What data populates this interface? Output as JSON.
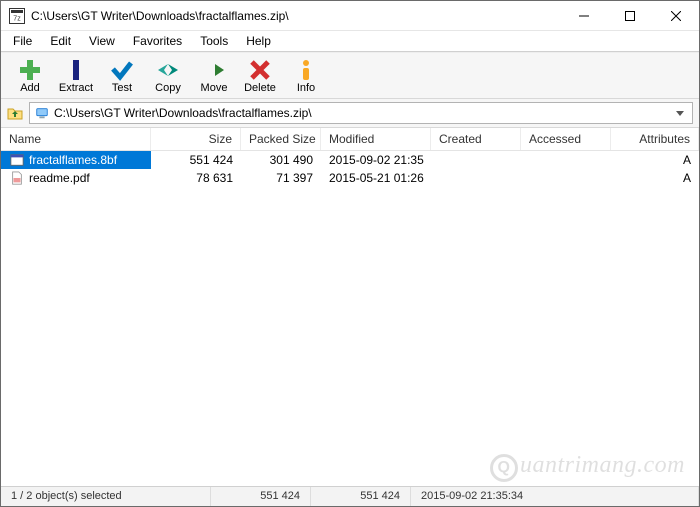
{
  "window": {
    "title": "C:\\Users\\GT Writer\\Downloads\\fractalflames.zip\\"
  },
  "menu": {
    "file": "File",
    "edit": "Edit",
    "view": "View",
    "favorites": "Favorites",
    "tools": "Tools",
    "help": "Help"
  },
  "toolbar": {
    "add": "Add",
    "extract": "Extract",
    "test": "Test",
    "copy": "Copy",
    "move": "Move",
    "delete": "Delete",
    "info": "Info"
  },
  "pathbar": {
    "path": "C:\\Users\\GT Writer\\Downloads\\fractalflames.zip\\"
  },
  "columns": {
    "name": "Name",
    "size": "Size",
    "packed": "Packed Size",
    "modified": "Modified",
    "created": "Created",
    "accessed": "Accessed",
    "attributes": "Attributes"
  },
  "rows": [
    {
      "name": "fractalflames.8bf",
      "size": "551 424",
      "packed": "301 490",
      "modified": "2015-09-02 21:35",
      "created": "",
      "accessed": "",
      "attributes": "A",
      "selected": true,
      "icon": "window"
    },
    {
      "name": "readme.pdf",
      "size": "78 631",
      "packed": "71 397",
      "modified": "2015-05-21 01:26",
      "created": "",
      "accessed": "",
      "attributes": "A",
      "selected": false,
      "icon": "pdf"
    }
  ],
  "status": {
    "selection": "1 / 2 object(s) selected",
    "size": "551 424",
    "packed": "551 424",
    "modified": "2015-09-02 21:35:34"
  },
  "watermark": "uantrimang.com"
}
